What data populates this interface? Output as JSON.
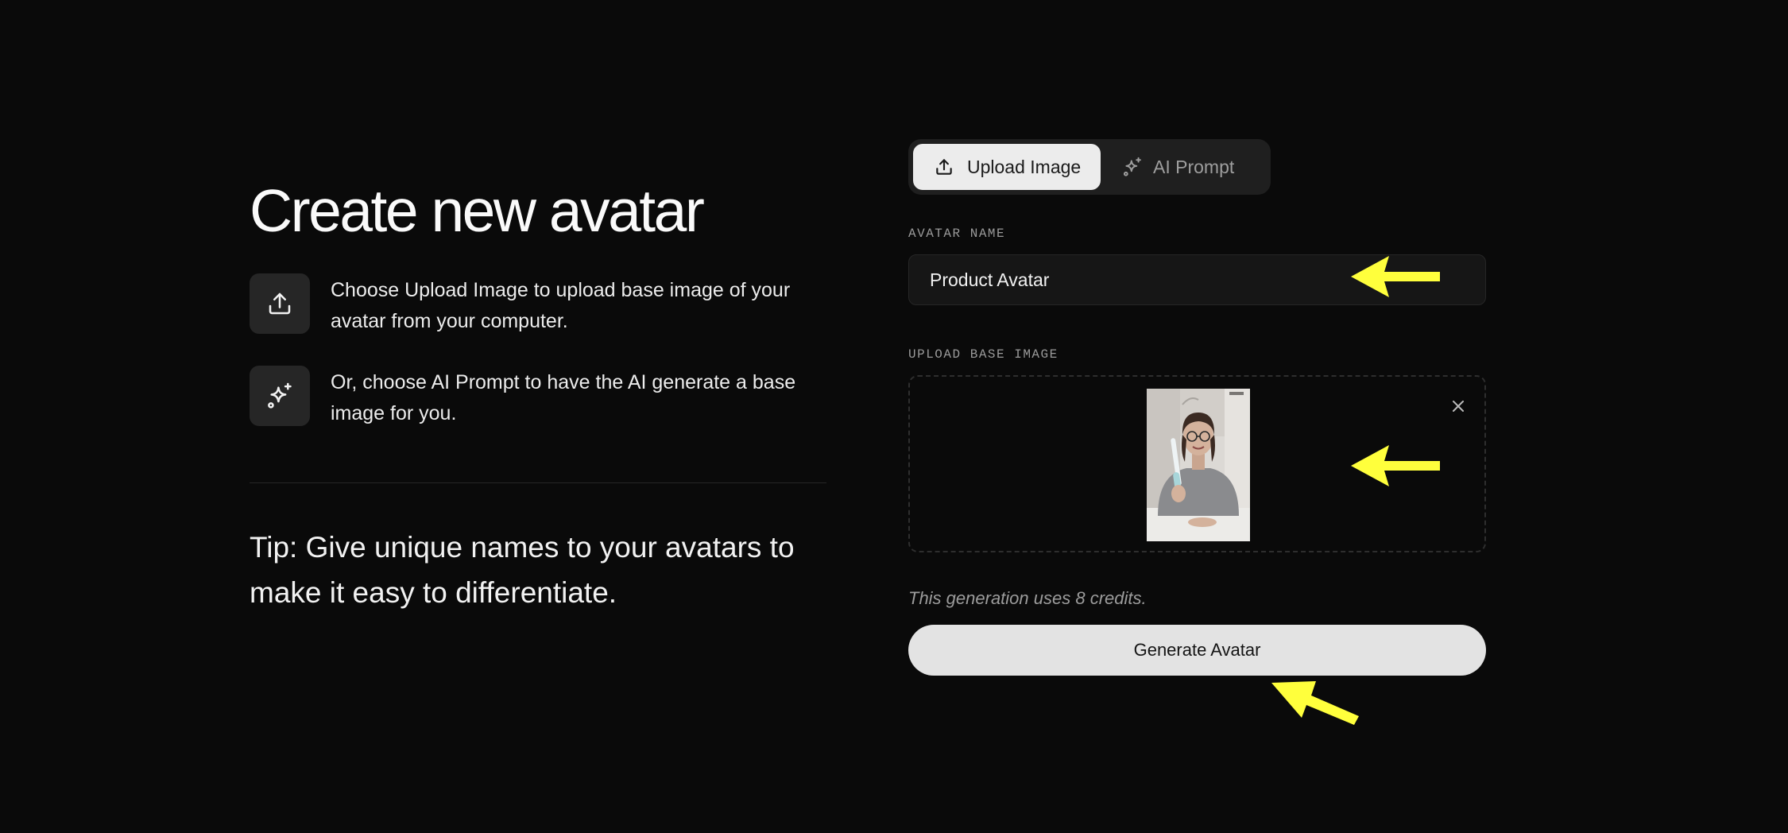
{
  "header": {
    "title": "Create new avatar"
  },
  "instructions": [
    {
      "icon": "upload-icon",
      "text": "Choose Upload Image to upload base image of your avatar from your computer."
    },
    {
      "icon": "sparkle-icon",
      "text": "Or, choose AI Prompt to have the AI generate a base image for you."
    }
  ],
  "tip": "Tip: Give unique names to your avatars to make it easy to differentiate.",
  "tabs": [
    {
      "icon": "upload-icon",
      "label": "Upload Image",
      "active": true
    },
    {
      "icon": "sparkle-icon",
      "label": "AI Prompt",
      "active": false
    }
  ],
  "form": {
    "name_label": "AVATAR NAME",
    "name_value": "Product Avatar",
    "upload_label": "UPLOAD BASE IMAGE",
    "credits_note": "This generation uses 8 credits.",
    "generate_label": "Generate Avatar"
  },
  "colors": {
    "background": "#0a0a0a",
    "annotation_arrow": "#ffff3c",
    "active_tab": "#ececec",
    "button": "#e3e3e3"
  }
}
